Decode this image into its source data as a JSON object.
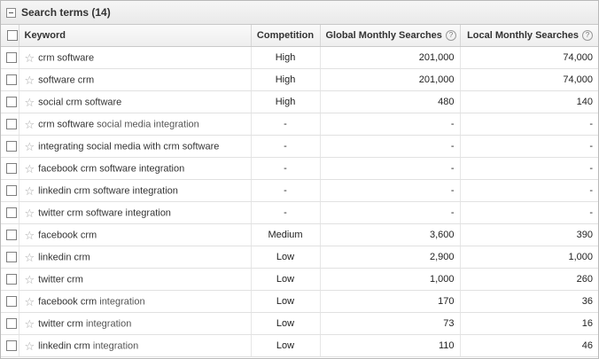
{
  "panel": {
    "title": "Search terms (14)"
  },
  "columns": {
    "keyword": "Keyword",
    "competition": "Competition",
    "global": "Global Monthly Searches",
    "local": "Local Monthly Searches"
  },
  "icons": {
    "collapse": "minus-box-icon",
    "star": "star-outline-icon",
    "help": "help-circle-icon"
  },
  "rows": [
    {
      "kw_bold": "crm software",
      "kw_rest": "",
      "competition": "High",
      "global": "201,000",
      "local": "74,000"
    },
    {
      "kw_bold": "software crm",
      "kw_rest": "",
      "competition": "High",
      "global": "201,000",
      "local": "74,000"
    },
    {
      "kw_bold": "social crm software",
      "kw_rest": "",
      "competition": "High",
      "global": "480",
      "local": "140"
    },
    {
      "kw_bold": "crm software",
      "kw_rest": " social media integration",
      "competition": "-",
      "global": "-",
      "local": "-"
    },
    {
      "kw_bold": "integrating social media with crm software",
      "kw_rest": "",
      "competition": "-",
      "global": "-",
      "local": "-"
    },
    {
      "kw_bold": "facebook crm software integration",
      "kw_rest": "",
      "competition": "-",
      "global": "-",
      "local": "-"
    },
    {
      "kw_bold": "linkedin crm software integration",
      "kw_rest": "",
      "competition": "-",
      "global": "-",
      "local": "-"
    },
    {
      "kw_bold": "twitter crm software integration",
      "kw_rest": "",
      "competition": "-",
      "global": "-",
      "local": "-"
    },
    {
      "kw_bold": "facebook crm",
      "kw_rest": "",
      "competition": "Medium",
      "global": "3,600",
      "local": "390"
    },
    {
      "kw_bold": "linkedin crm",
      "kw_rest": "",
      "competition": "Low",
      "global": "2,900",
      "local": "1,000"
    },
    {
      "kw_bold": "twitter crm",
      "kw_rest": "",
      "competition": "Low",
      "global": "1,000",
      "local": "260"
    },
    {
      "kw_bold": "facebook crm",
      "kw_rest": " integration",
      "competition": "Low",
      "global": "170",
      "local": "36"
    },
    {
      "kw_bold": "twitter crm",
      "kw_rest": " integration",
      "competition": "Low",
      "global": "73",
      "local": "16"
    },
    {
      "kw_bold": "linkedin crm",
      "kw_rest": " integration",
      "competition": "Low",
      "global": "110",
      "local": "46"
    }
  ]
}
